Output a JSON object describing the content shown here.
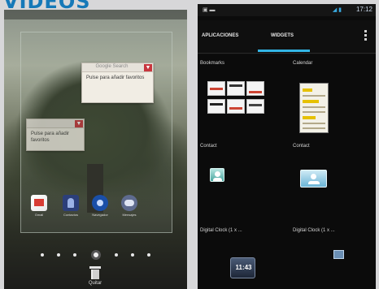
{
  "page": {
    "headline": "VÍDEOS"
  },
  "left_phone": {
    "widgets": [
      {
        "header": "Google Search",
        "text": "Pulse para añadir favoritos"
      },
      {
        "header": "",
        "text": "Pulse para añadir favoritos"
      }
    ],
    "apps": [
      {
        "icon": "gmail-icon",
        "label": "Gmail"
      },
      {
        "icon": "contacts-icon",
        "label": "Contactos"
      },
      {
        "icon": "browser-icon",
        "label": "Navegador"
      },
      {
        "icon": "messaging-icon",
        "label": "Mensajes"
      }
    ],
    "trash_label": "Quitar"
  },
  "right_phone": {
    "statusbar": {
      "left": "▣ ▬",
      "time": "17:12"
    },
    "tabs": [
      {
        "label": "APLICACIONES",
        "selected": false
      },
      {
        "label": "WIDGETS",
        "selected": true
      }
    ],
    "widget_labels": [
      "Bookmarks",
      "Calendar",
      "Contact",
      "Contact",
      "Digital Clock (1 x ...",
      "Digital Clock (1 x ..."
    ],
    "clock_preview_time": "11:43"
  },
  "colors": {
    "accent": "#33b5e5",
    "headline": "#1679b8",
    "close": "#c8363e"
  }
}
